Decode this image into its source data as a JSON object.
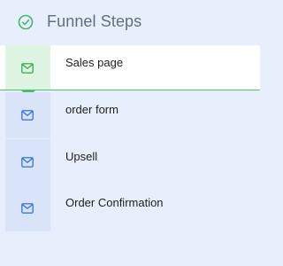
{
  "header": {
    "title": "Funnel Steps",
    "icon": "check-circle-icon",
    "icon_color": "#46b865"
  },
  "steps": [
    {
      "label": "Sales page",
      "icon": "mail-icon",
      "active": true
    },
    {
      "label": "order form",
      "icon": "mail-icon",
      "active": false
    },
    {
      "label": "Upsell",
      "icon": "mail-icon",
      "active": false
    },
    {
      "label": "Order Confirmation",
      "icon": "mail-icon",
      "active": false
    }
  ],
  "colors": {
    "background": "#e6effb",
    "active_step": "#ffffff",
    "active_accent": "#52c26a",
    "inactive_icon": "#3b78e7",
    "rail": "#d9e4f8",
    "connector_blue": "#9ec3f4"
  }
}
